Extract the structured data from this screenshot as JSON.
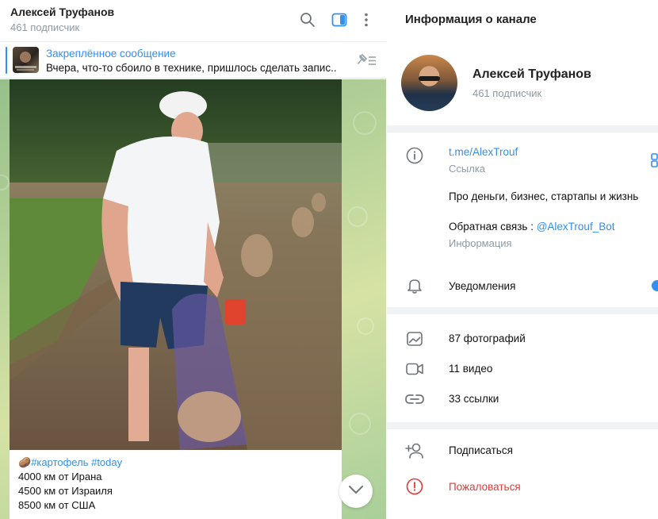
{
  "chat": {
    "title": "Алексей Труфанов",
    "subscribers": "461 подписчик",
    "pinned": {
      "title": "Закреплённое сообщение",
      "text": "Вчера, что-то сбоило в технике, пришлось сделать запис..."
    },
    "message": {
      "emoji": "🥔",
      "hashtag1": "#картофель",
      "hashtag2": "#today",
      "lines": [
        "4000 км от Ирана",
        "4500 км от Израиля",
        "8500 км от США"
      ]
    },
    "icons": [
      "search-icon",
      "sidebar-toggle-icon",
      "more-vert-icon",
      "pinned-list-icon",
      "chevron-down-icon"
    ]
  },
  "info": {
    "header": "Информация о канале",
    "name": "Алексей Труфанов",
    "subscribers": "461 подписчик",
    "link": "t.me/AlexTrouf",
    "link_label": "Ссылка",
    "description": "Про деньги, бизнес, стартапы и жизнь",
    "feedback_prefix": "Обратная связь : ",
    "feedback_handle": "@AlexTrouf_Bot",
    "info_label": "Информация",
    "notifications": "Уведомления",
    "notifications_on": true,
    "media": {
      "photos": "87 фотографий",
      "videos": "11 видео",
      "links": "33 ссылки"
    },
    "subscribe": "Подписаться",
    "report": "Пожаловаться"
  },
  "colors": {
    "accent": "#3390ec",
    "danger": "#e53935",
    "muted": "#8f9aa3"
  }
}
